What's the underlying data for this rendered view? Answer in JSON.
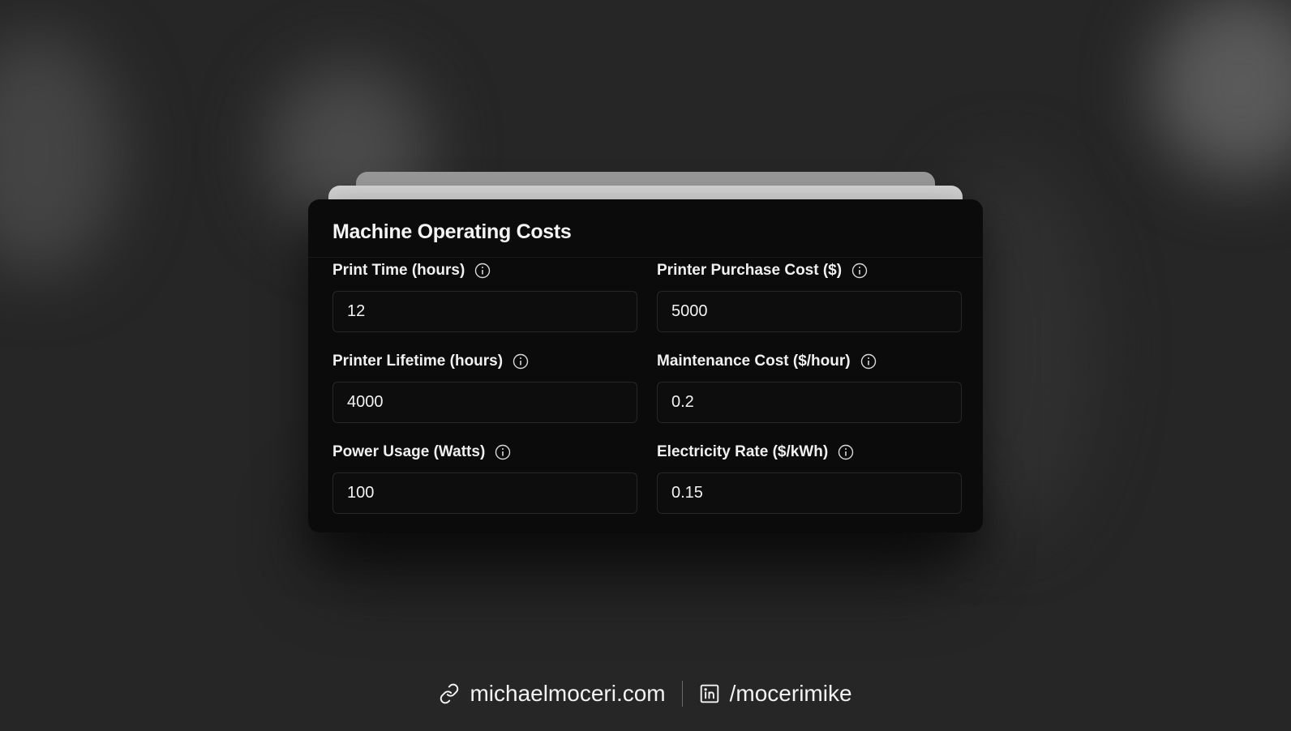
{
  "card": {
    "title": "Machine Operating Costs"
  },
  "fields": [
    {
      "label": "Print Time (hours)",
      "value": "12"
    },
    {
      "label": "Printer Purchase Cost ($)",
      "value": "5000"
    },
    {
      "label": "Printer Lifetime (hours)",
      "value": "4000"
    },
    {
      "label": "Maintenance Cost ($/hour)",
      "value": "0.2"
    },
    {
      "label": "Power Usage (Watts)",
      "value": "100"
    },
    {
      "label": "Electricity Rate ($/kWh)",
      "value": "0.15"
    }
  ],
  "footer": {
    "website": "michaelmoceri.com",
    "website_icon": "link-icon",
    "linkedin": "/mocerimike",
    "linkedin_icon": "linkedin-icon"
  },
  "colors": {
    "background": "#262626",
    "card": "#0b0b0b",
    "input_bg": "#0d0d0d",
    "input_border": "#262626",
    "text": "#f2f2f2"
  }
}
